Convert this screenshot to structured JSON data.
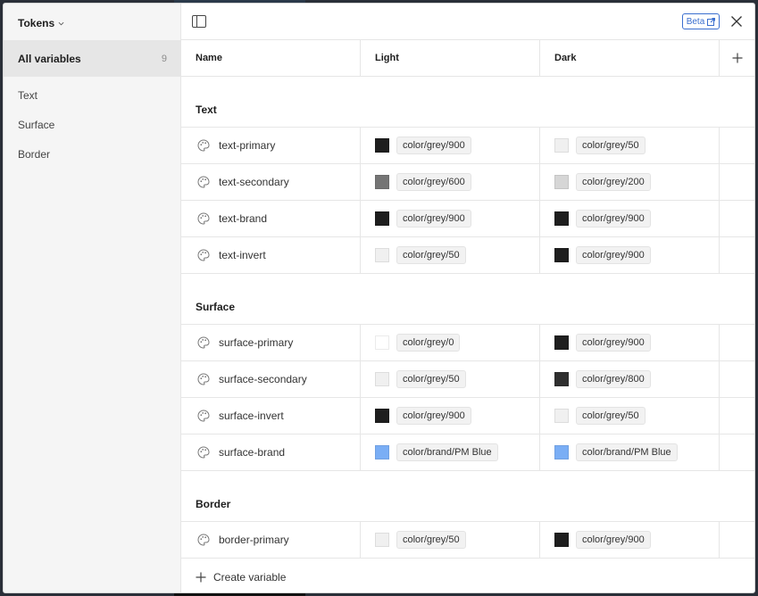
{
  "sidebar": {
    "collection_name": "Tokens",
    "all_variables_label": "All variables",
    "all_variables_count": "9",
    "groups": [
      "Text",
      "Surface",
      "Border"
    ]
  },
  "topbar": {
    "beta_label": "Beta"
  },
  "columns": {
    "name": "Name",
    "light": "Light",
    "dark": "Dark"
  },
  "sections": [
    {
      "title": "Text",
      "rows": [
        {
          "name": "text-primary",
          "light": {
            "value": "color/grey/900",
            "color": "#1e1e1e"
          },
          "dark": {
            "value": "color/grey/50",
            "color": "#f0f0f0"
          }
        },
        {
          "name": "text-secondary",
          "light": {
            "value": "color/grey/600",
            "color": "#757575"
          },
          "dark": {
            "value": "color/grey/200",
            "color": "#d6d6d6"
          }
        },
        {
          "name": "text-brand",
          "light": {
            "value": "color/grey/900",
            "color": "#1e1e1e"
          },
          "dark": {
            "value": "color/grey/900",
            "color": "#1e1e1e"
          }
        },
        {
          "name": "text-invert",
          "light": {
            "value": "color/grey/50",
            "color": "#f0f0f0"
          },
          "dark": {
            "value": "color/grey/900",
            "color": "#1e1e1e"
          }
        }
      ]
    },
    {
      "title": "Surface",
      "rows": [
        {
          "name": "surface-primary",
          "light": {
            "value": "color/grey/0",
            "color": "#ffffff"
          },
          "dark": {
            "value": "color/grey/900",
            "color": "#1e1e1e"
          }
        },
        {
          "name": "surface-secondary",
          "light": {
            "value": "color/grey/50",
            "color": "#f0f0f0"
          },
          "dark": {
            "value": "color/grey/800",
            "color": "#2f2f2f"
          }
        },
        {
          "name": "surface-invert",
          "light": {
            "value": "color/grey/900",
            "color": "#1e1e1e"
          },
          "dark": {
            "value": "color/grey/50",
            "color": "#f0f0f0"
          }
        },
        {
          "name": "surface-brand",
          "light": {
            "value": "color/brand/PM Blue",
            "color": "#7aaef5"
          },
          "dark": {
            "value": "color/brand/PM Blue",
            "color": "#7aaef5"
          }
        }
      ]
    },
    {
      "title": "Border",
      "rows": [
        {
          "name": "border-primary",
          "light": {
            "value": "color/grey/50",
            "color": "#f0f0f0"
          },
          "dark": {
            "value": "color/grey/900",
            "color": "#1e1e1e"
          }
        }
      ]
    }
  ],
  "create_variable_label": "Create variable"
}
